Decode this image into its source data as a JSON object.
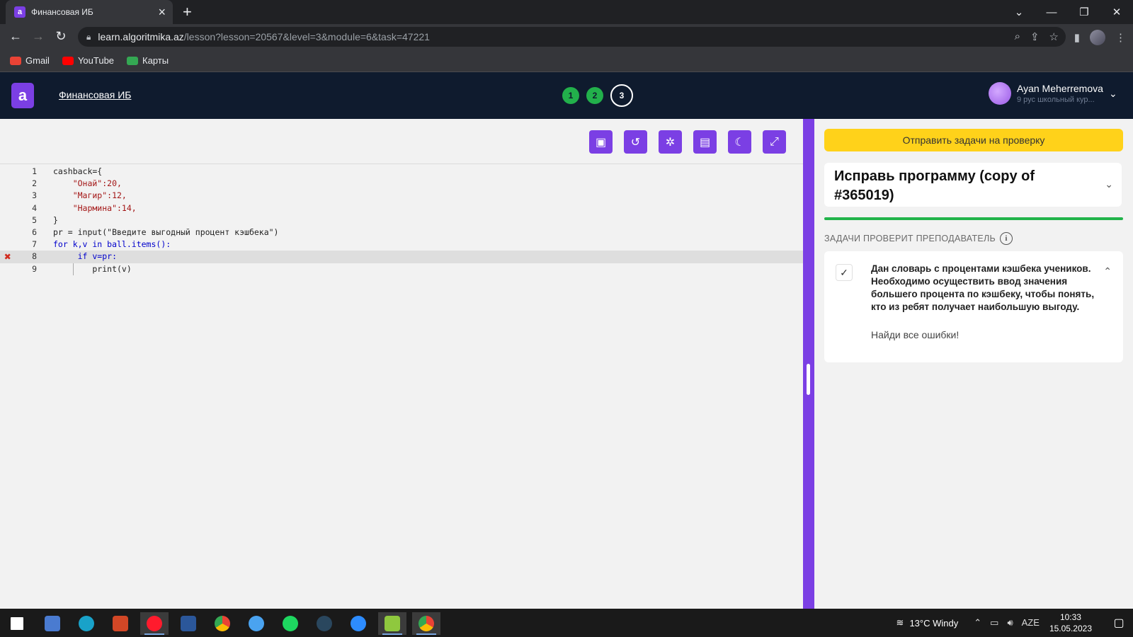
{
  "browser": {
    "tab_title": "Финансовая ИБ",
    "url_host": "learn.algoritmika.az",
    "url_path": "/lesson?lesson=20567&level=3&module=6&task=47221",
    "bookmarks": [
      {
        "label": "Gmail"
      },
      {
        "label": "YouTube"
      },
      {
        "label": "Карты"
      }
    ]
  },
  "header": {
    "logo": "a",
    "course_title": "Финансовая ИБ",
    "steps": [
      "1",
      "2",
      "3"
    ],
    "active_step": "3",
    "user_name": "Ayan Meherremova",
    "user_sub": "9 рус школьный кур..."
  },
  "editor": {
    "lines": [
      {
        "num": "1",
        "text": "cashback={"
      },
      {
        "num": "2",
        "text": "    \"Онай\":20,"
      },
      {
        "num": "3",
        "text": "    \"Магир\":12,"
      },
      {
        "num": "4",
        "text": "    \"Нармина\":14,"
      },
      {
        "num": "5",
        "text": "}"
      },
      {
        "num": "6",
        "text": "pr = input(\"Введите выгодный процент кэшбека\")"
      },
      {
        "num": "7",
        "text": "for k,v in ball.items():"
      },
      {
        "num": "8",
        "text": "     if v=pr:",
        "error": true
      },
      {
        "num": "9",
        "text": "        print(v)"
      }
    ]
  },
  "side": {
    "submit_label": "Отправить задачи на проверку",
    "task_title": "Исправь программу (copy of #365019)",
    "check_label": "ЗАДАЧИ ПРОВЕРИТ ПРЕПОДАВАТЕЛЬ",
    "description": "Дан словарь с процентами кэшбека учеников. Необходимо осуществить ввод значения большего процента по кэшбеку, чтобы понять, кто из ребят получает наибольшую выгоду.",
    "hint": "Найди все ошибки!"
  },
  "taskbar": {
    "weather": "13°C  Windy",
    "lang": "AZE",
    "time": "10:33",
    "date": "15.05.2023"
  },
  "colors": {
    "accent": "#7b3fe4",
    "submit": "#ffd21a",
    "success": "#21b34a",
    "header_bg": "#0f1b2e",
    "error": "#d12b1e"
  }
}
